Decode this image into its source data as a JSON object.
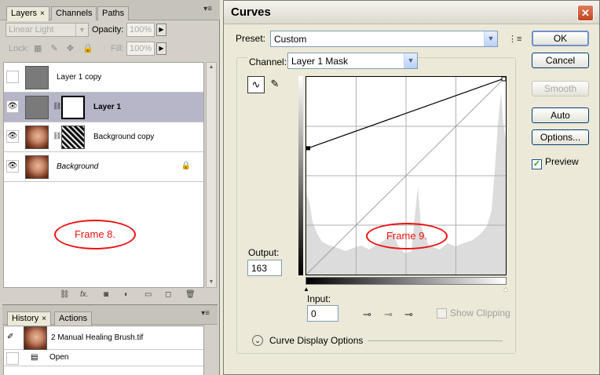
{
  "layers_panel": {
    "tabs": [
      "Layers",
      "Channels",
      "Paths"
    ],
    "tab_close": "×",
    "blend_mode": "Linear Light",
    "opacity_label": "Opacity:",
    "opacity_value": "100%",
    "lock_label": "Lock:",
    "fill_label": "Fill:",
    "fill_value": "100%",
    "layers": [
      {
        "name": "Layer 1 copy",
        "visible": false,
        "selected": false
      },
      {
        "name": "Layer 1",
        "visible": true,
        "selected": true
      },
      {
        "name": "Background copy",
        "visible": true,
        "selected": false
      },
      {
        "name": "Background",
        "visible": true,
        "selected": false,
        "locked": true
      }
    ],
    "annotation": "Frame 8."
  },
  "history_panel": {
    "tabs": [
      "History",
      "Actions"
    ],
    "tab_close": "×",
    "items": [
      "2 Manual Healing Brush.tif",
      "Open"
    ]
  },
  "curves_dialog": {
    "title": "Curves",
    "preset_label": "Preset:",
    "preset_value": "Custom",
    "channel_label": "Channel:",
    "channel_value": "Layer 1 Mask",
    "output_label": "Output:",
    "output_value": "163",
    "input_label": "Input:",
    "input_value": "0",
    "show_clipping_label": "Show Clipping",
    "curve_display_options": "Curve Display Options",
    "annotation": "Frame 9.",
    "buttons": {
      "ok": "OK",
      "cancel": "Cancel",
      "smooth": "Smooth",
      "auto": "Auto",
      "options": "Options..."
    },
    "preview_label": "Preview",
    "preview_checked": true,
    "curve_points": [
      {
        "input": 0,
        "output": 163
      },
      {
        "input": 255,
        "output": 255
      }
    ]
  },
  "colors": {
    "annotation": "#e11111",
    "selected_row": "#b6b6c8",
    "close_button": "#c2451f"
  }
}
